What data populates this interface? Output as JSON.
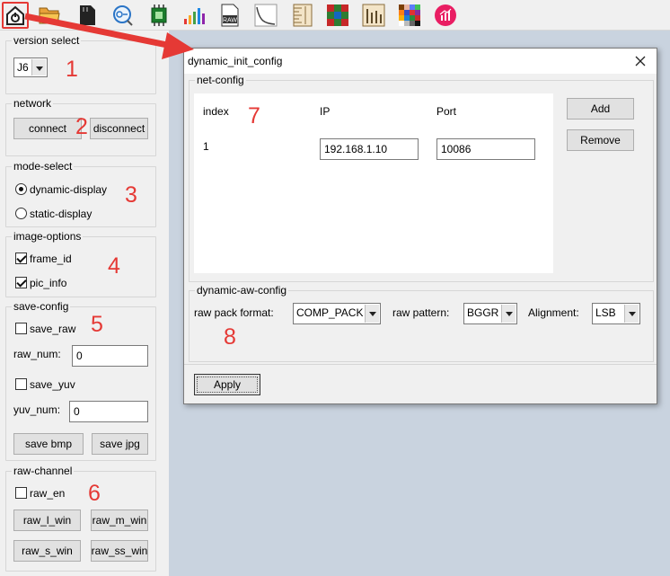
{
  "toolbar": {
    "icons": [
      "home-icon",
      "folder-icon",
      "sd-card-icon",
      "zoom-icon",
      "chip-icon",
      "bar-chart-icon",
      "raw-file-icon",
      "curve-icon",
      "ruler-icon",
      "color-grid-icon",
      "bar-line-icon",
      "color-checker-icon",
      "report-chart-icon"
    ],
    "raw_label": "RAW"
  },
  "left_panel": {
    "version_select": {
      "title": "version select",
      "value": "J6"
    },
    "network": {
      "title": "network",
      "connect": "connect",
      "disconnect": "disconnect"
    },
    "mode_select": {
      "title": "mode-select",
      "dynamic": "dynamic-display",
      "static": "static-display",
      "selected": "dynamic-display"
    },
    "image_options": {
      "title": "image-options",
      "frame_id": "frame_id",
      "pic_info": "pic_info",
      "frame_id_checked": true,
      "pic_info_checked": true
    },
    "save_config": {
      "title": "save-config",
      "save_raw": "save_raw",
      "raw_num_label": "raw_num:",
      "raw_num": "0",
      "save_yuv": "save_yuv",
      "yuv_num_label": "yuv_num:",
      "yuv_num": "0",
      "save_bmp": "save bmp",
      "save_jpg": "save jpg"
    },
    "raw_channel": {
      "title": "raw-channel",
      "raw_en": "raw_en",
      "raw_l_win": "raw_l_win",
      "raw_m_win": "raw_m_win",
      "raw_s_win": "raw_s_win",
      "raw_ss_win": "raw_ss_win"
    }
  },
  "annotations": [
    "1",
    "2",
    "3",
    "4",
    "5",
    "6",
    "7",
    "8"
  ],
  "dialog": {
    "title": "dynamic_init_config",
    "net_config": {
      "title": "net-config",
      "headers": [
        "index",
        "IP",
        "Port"
      ],
      "rows": [
        {
          "index": "1",
          "ip": "192.168.1.10",
          "port": "10086"
        }
      ],
      "add": "Add",
      "remove": "Remove"
    },
    "aw_config": {
      "title": "dynamic-aw-config",
      "raw_pack_format_label": "raw pack format:",
      "raw_pack_format": "COMP_PACK",
      "raw_pattern_label": "raw pattern:",
      "raw_pattern": "BGGR",
      "alignment_label": "Alignment:",
      "alignment": "LSB"
    },
    "apply": "Apply"
  },
  "colors": {
    "annotation": "#e53935",
    "background": "#c9d3df",
    "panel": "#f0f0f0"
  }
}
